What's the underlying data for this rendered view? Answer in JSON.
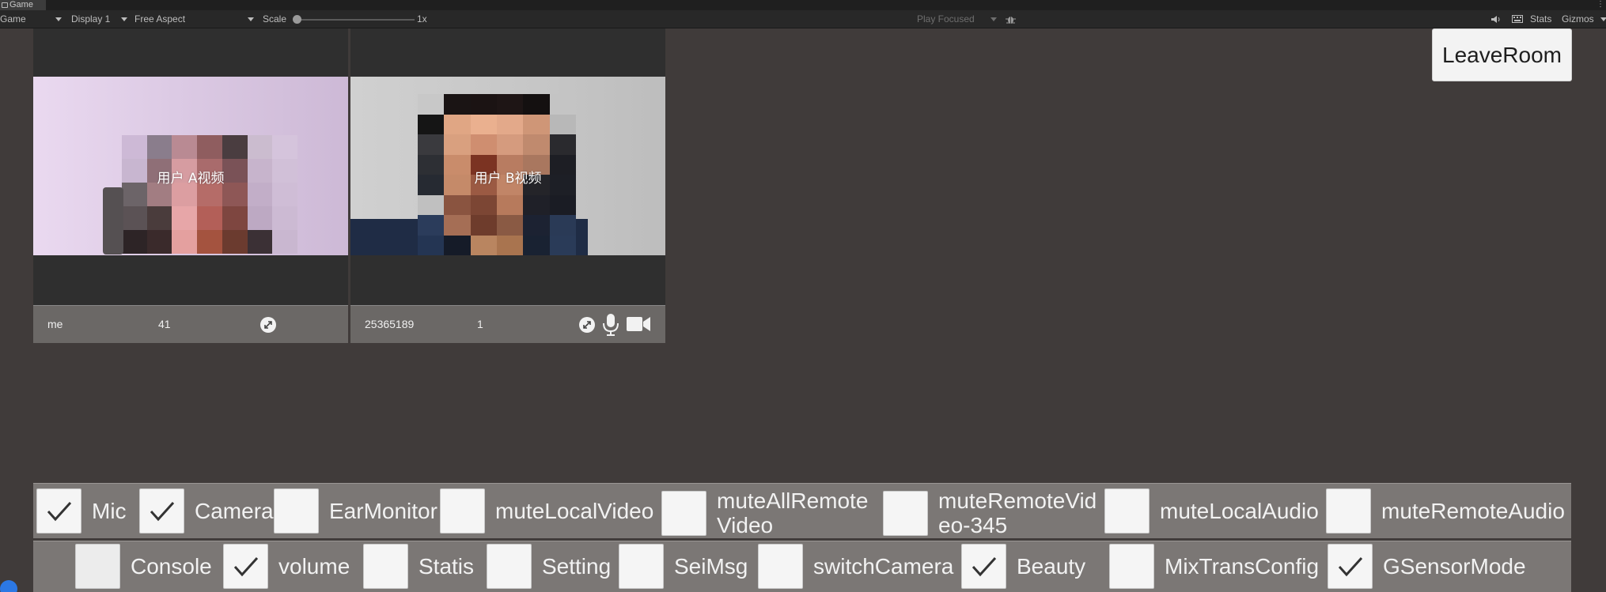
{
  "window": {
    "tab_label": "Game"
  },
  "toolbar": {
    "mode": "Game",
    "display": "Display 1",
    "aspect": "Free Aspect",
    "scale_label": "Scale",
    "scale_value": "1x",
    "play_mode": "Play Focused",
    "stats": "Stats",
    "gizmos": "Gizmos"
  },
  "videos": [
    {
      "label": "用户 A视频",
      "user": "me",
      "count": "41"
    },
    {
      "label": "用户 B视频",
      "user": "25365189",
      "count": "1"
    }
  ],
  "leave_button": "LeaveRoom",
  "row1": [
    {
      "label": "Mic",
      "checked": true
    },
    {
      "label": "Camera",
      "checked": true
    },
    {
      "label": "EarMonitor",
      "checked": false
    },
    {
      "label": "muteLocalVideo",
      "checked": false
    },
    {
      "label": "muteAllRemoteVideo",
      "checked": false
    },
    {
      "label": "muteRemoteVideo-345",
      "checked": false
    },
    {
      "label": "muteLocalAudio",
      "checked": false
    },
    {
      "label": "muteRemoteAudio",
      "checked": false
    }
  ],
  "row2": [
    {
      "label": "Console",
      "checked": false
    },
    {
      "label": "volume",
      "checked": true
    },
    {
      "label": "Statis",
      "checked": false
    },
    {
      "label": "Setting",
      "checked": false
    },
    {
      "label": "SeiMsg",
      "checked": false
    },
    {
      "label": "switchCamera",
      "checked": false
    },
    {
      "label": "Beauty",
      "checked": true
    },
    {
      "label": "MixTransConfig",
      "checked": false
    },
    {
      "label": "GSensorMode",
      "checked": true
    }
  ]
}
